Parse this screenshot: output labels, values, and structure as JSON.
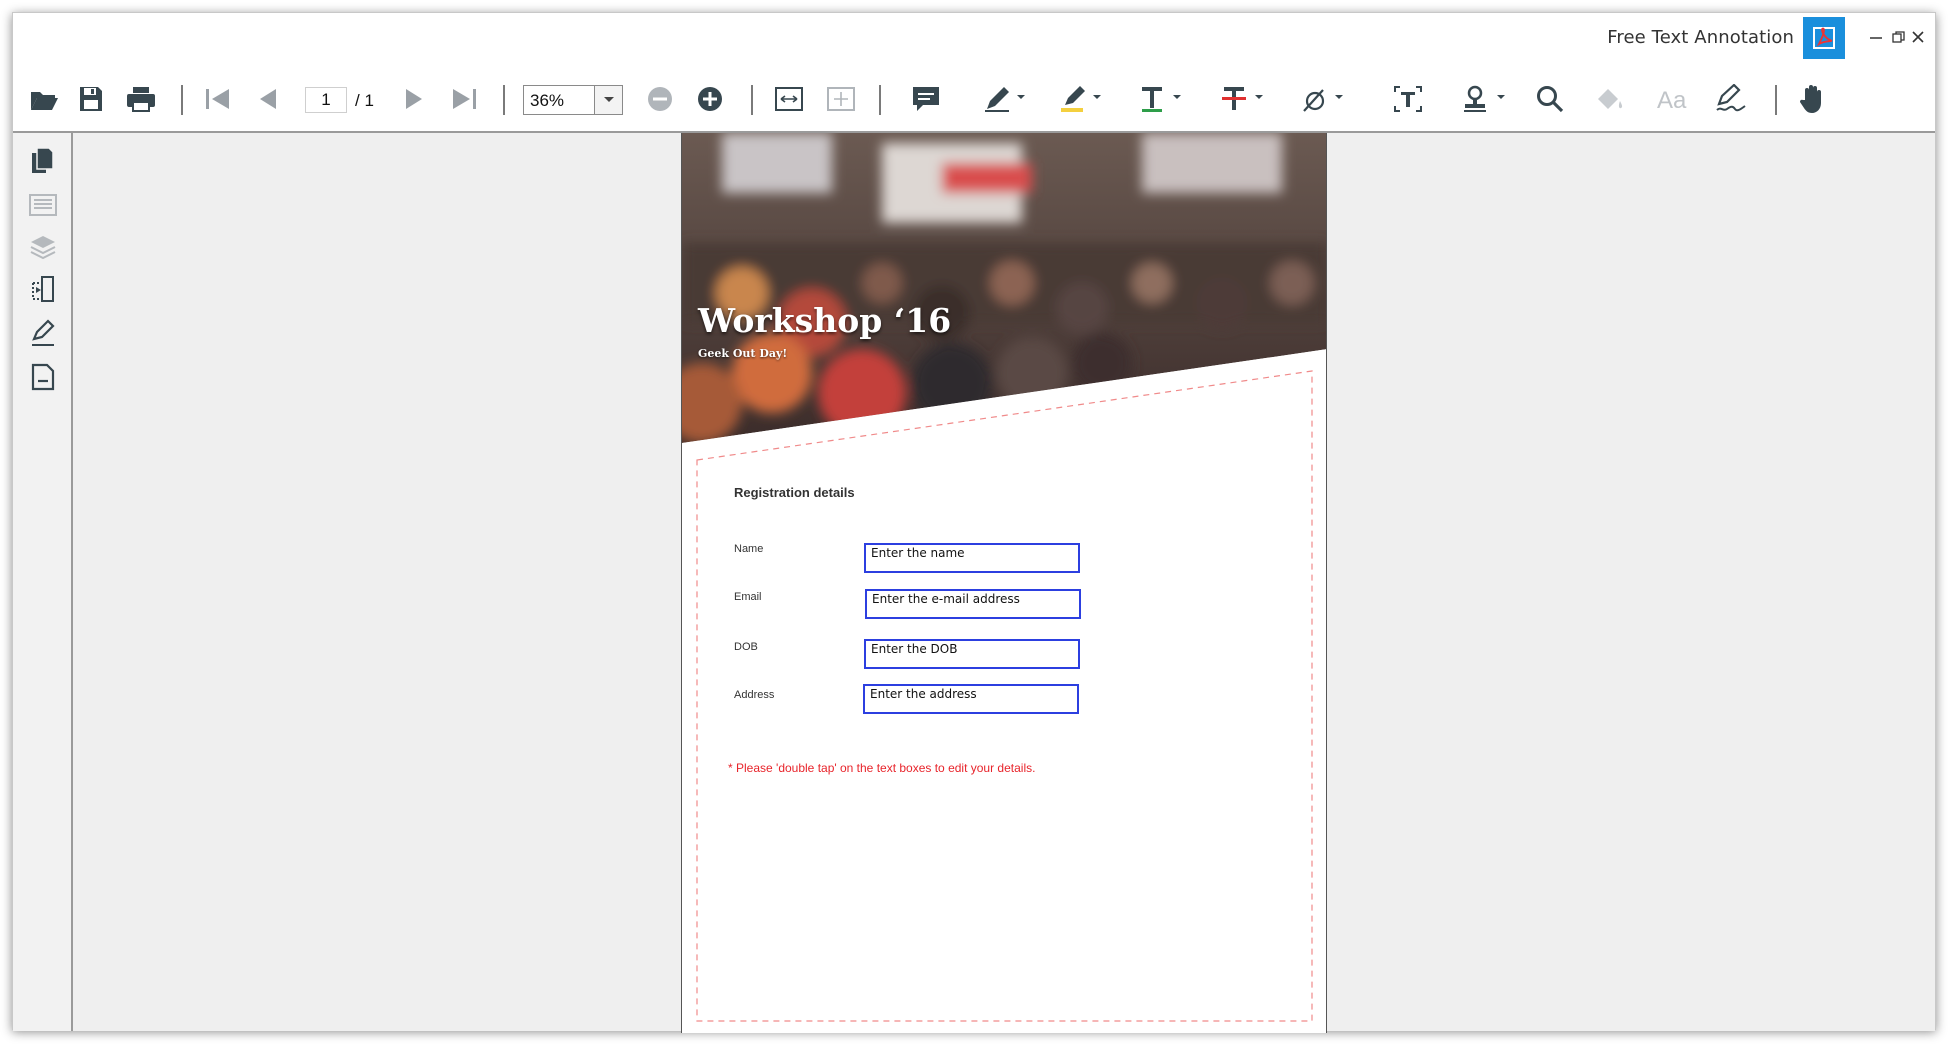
{
  "window": {
    "title": "Free Text Annotation"
  },
  "toolbar": {
    "page_current": "1",
    "page_total": "/ 1",
    "zoom": "36%"
  },
  "sidebar": {
    "items": [
      "pages-icon",
      "bookmarks-icon",
      "layers-icon",
      "organize-pages-icon",
      "signature-icon",
      "document-icon"
    ]
  },
  "document": {
    "hero_title": "Workshop ‘16",
    "hero_subtitle": "Geek Out Day!",
    "section_title": "Registration details",
    "fields": [
      {
        "label": "Name",
        "value": "Enter the name"
      },
      {
        "label": "Email",
        "value": "Enter the e-mail address"
      },
      {
        "label": "DOB",
        "value": "Enter the DOB"
      },
      {
        "label": "Address",
        "value": "Enter the address"
      }
    ],
    "note": "* Please 'double tap' on the text boxes to edit your details."
  },
  "colors": {
    "accent": "#1a8fdc",
    "field_border": "#2c3fe0",
    "note": "#e8242b",
    "dashed": "#f08a8a"
  }
}
